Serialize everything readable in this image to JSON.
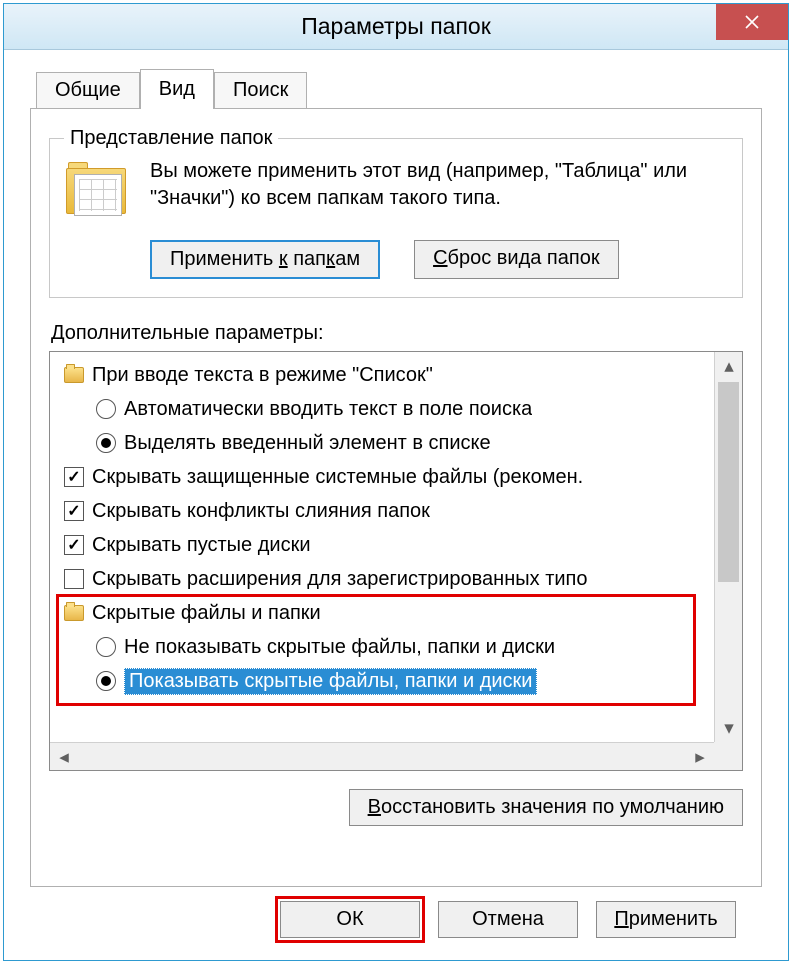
{
  "window": {
    "title": "Параметры папок"
  },
  "tabs": {
    "general": "Общие",
    "view": "Вид",
    "search": "Поиск"
  },
  "group": {
    "legend": "Представление папок",
    "description": "Вы можете применить этот вид (например, \"Таблица\" или \"Значки\") ко всем папкам такого типа.",
    "apply_btn": "Применить к папкам",
    "apply_u": "к",
    "reset_btn": "Сброс вида папок",
    "reset_u": "С"
  },
  "advanced_label": "Дополнительные параметры:",
  "tree": {
    "r0": "При вводе текста в режиме \"Список\"",
    "r1": "Автоматически вводить текст в поле поиска",
    "r2": "Выделять введенный элемент в списке",
    "r3": "Скрывать защищенные системные файлы (рекомен.",
    "r4": "Скрывать конфликты слияния папок",
    "r5": "Скрывать пустые диски",
    "r6": "Скрывать расширения для зарегистрированных типо",
    "r7": "Скрытые файлы и папки",
    "r8": "Не показывать скрытые файлы, папки и диски",
    "r9": "Показывать скрытые файлы, папки и диски"
  },
  "restore_btn": "Восстановить значения по умолчанию",
  "restore_u": "В",
  "buttons": {
    "ok": "ОК",
    "cancel": "Отмена",
    "apply": "Применить",
    "apply_u": "П"
  }
}
